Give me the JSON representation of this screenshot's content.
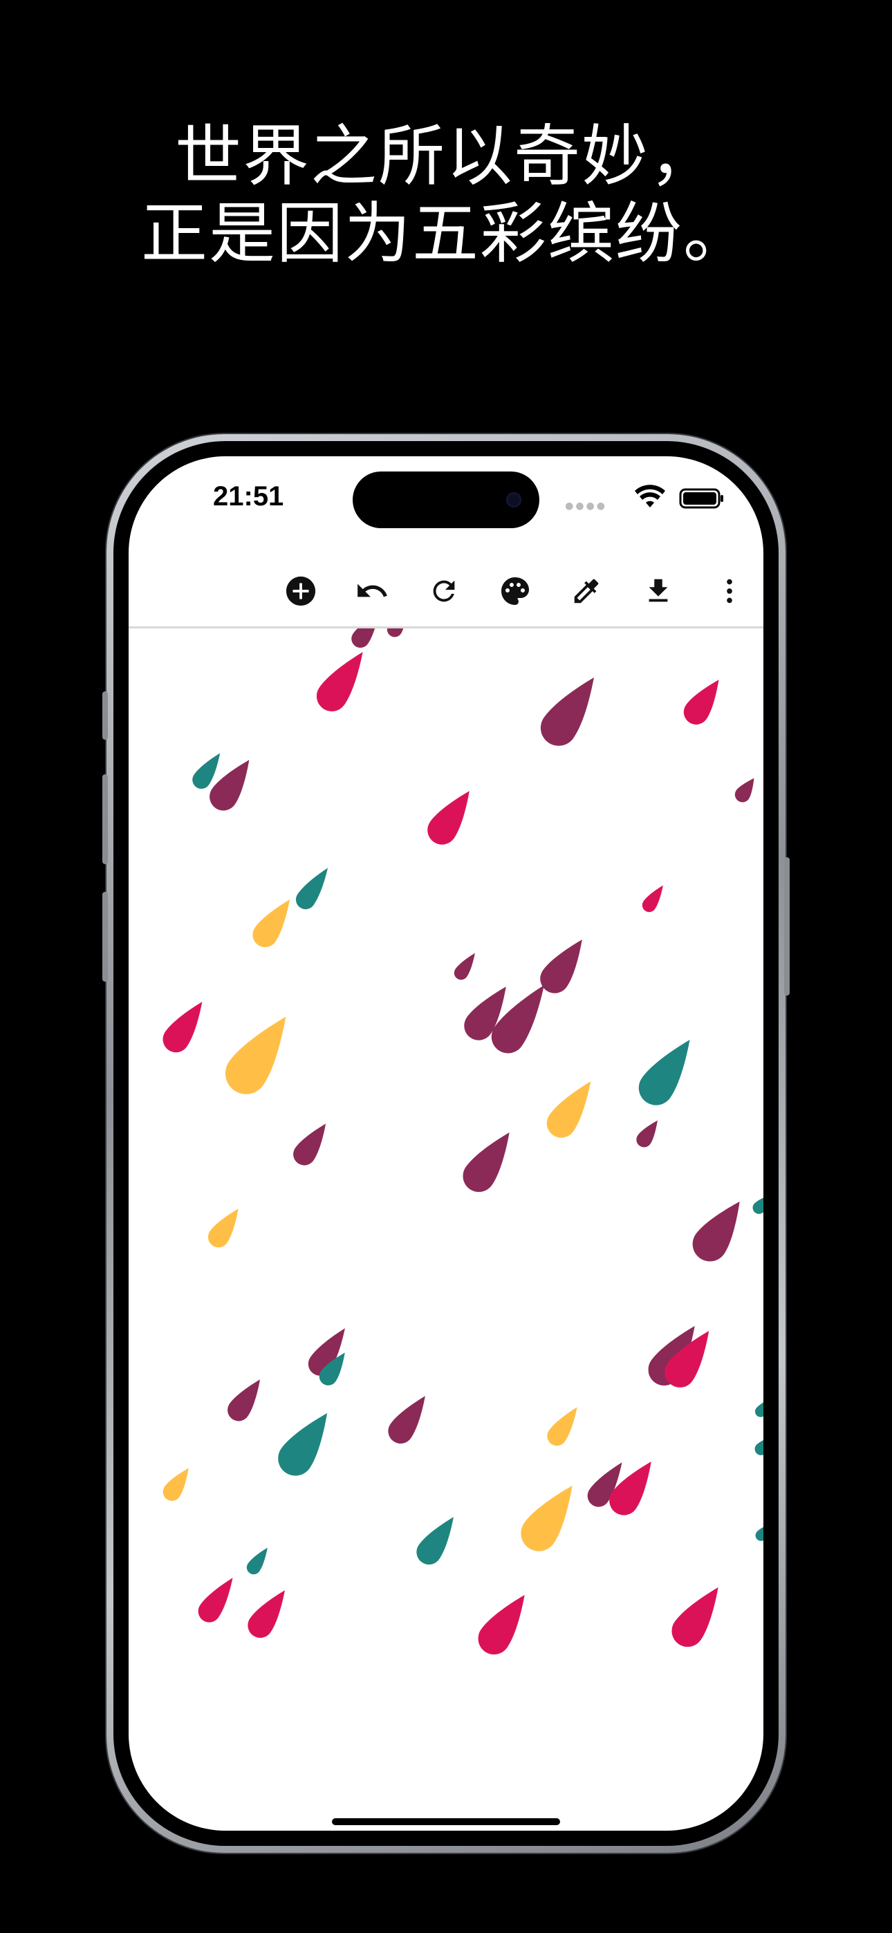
{
  "headline": {
    "line1": "世界之所以奇妙，",
    "line2": "正是因为五彩缤纷。"
  },
  "status_bar": {
    "time": "21:51",
    "icons": [
      "wifi-icon",
      "battery-icon"
    ]
  },
  "toolbar": {
    "tools": [
      {
        "name": "add-circle-icon"
      },
      {
        "name": "undo-icon"
      },
      {
        "name": "redo-icon"
      },
      {
        "name": "palette-icon"
      },
      {
        "name": "eyedropper-icon"
      },
      {
        "name": "download-icon"
      },
      {
        "name": "more-vert-icon"
      }
    ]
  },
  "colors": {
    "magenta": "#DC1259",
    "plum": "#8B2A56",
    "teal": "#1F8580",
    "yellow": "#FFBF47"
  }
}
